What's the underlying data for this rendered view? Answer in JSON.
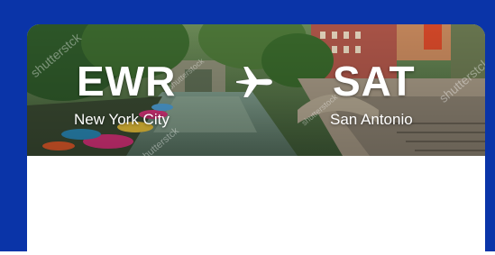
{
  "flight": {
    "origin": {
      "code": "EWR",
      "city": "New York City"
    },
    "destination": {
      "code": "SAT",
      "city": "San Antonio"
    },
    "plane_icon": "airplane-icon"
  },
  "watermark": {
    "text": "shutterstck",
    "small_text": "shutterstock"
  },
  "colors": {
    "frame": "#0a34a8",
    "card": "#ffffff",
    "text": "#ffffff"
  }
}
